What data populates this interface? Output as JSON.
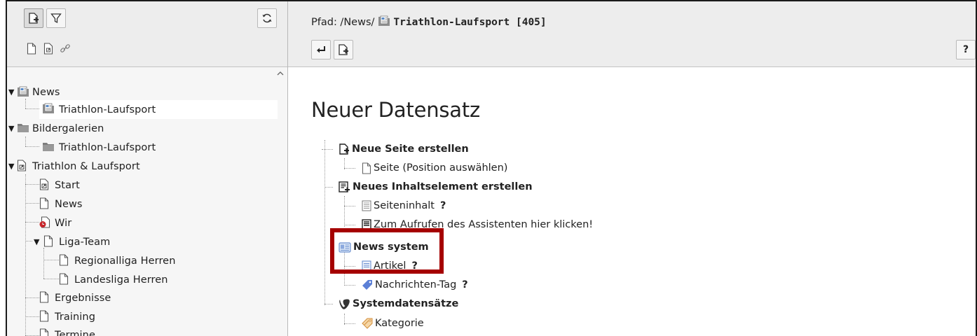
{
  "left_toolbar": {
    "new_page_btn": "new-page",
    "filter_btn": "filter",
    "refresh_btn": "refresh"
  },
  "tree": {
    "items": [
      {
        "label": "News"
      },
      {
        "label": "Triathlon-Laufsport"
      },
      {
        "label": "Bildergalerien"
      },
      {
        "label": "Triathlon-Laufsport"
      },
      {
        "label": "Triathlon & Laufsport"
      },
      {
        "label": "Start"
      },
      {
        "label": "News"
      },
      {
        "label": "Wir"
      },
      {
        "label": "Liga-Team"
      },
      {
        "label": "Regionalliga Herren"
      },
      {
        "label": "Landesliga Herren"
      },
      {
        "label": "Ergebnisse"
      },
      {
        "label": "Training"
      },
      {
        "label": "Termine"
      }
    ]
  },
  "docheader": {
    "path_prefix": "Pfad: /News/",
    "page_title": "Triathlon-Laufsport [405]",
    "help_button": "?"
  },
  "content": {
    "heading": "Neuer Datensatz",
    "rows": [
      {
        "label": "Neue Seite erstellen"
      },
      {
        "label": "Seite (Position auswählen)"
      },
      {
        "label": "Neues Inhaltselement erstellen"
      },
      {
        "label": "Seiteninhalt",
        "help": "?"
      },
      {
        "label": "Zum Aufrufen des Assistenten hier klicken!"
      },
      {
        "label": "News system"
      },
      {
        "label": "Artikel",
        "help": "?"
      },
      {
        "label": "Nachrichten-Tag",
        "help": "?"
      },
      {
        "label": "Systemdatensätze"
      },
      {
        "label": "Kategorie"
      }
    ]
  },
  "colors": {
    "highlight_border": "#a50000",
    "toolbar_bg": "#ededed",
    "tree_bg": "#f6f6f6"
  }
}
